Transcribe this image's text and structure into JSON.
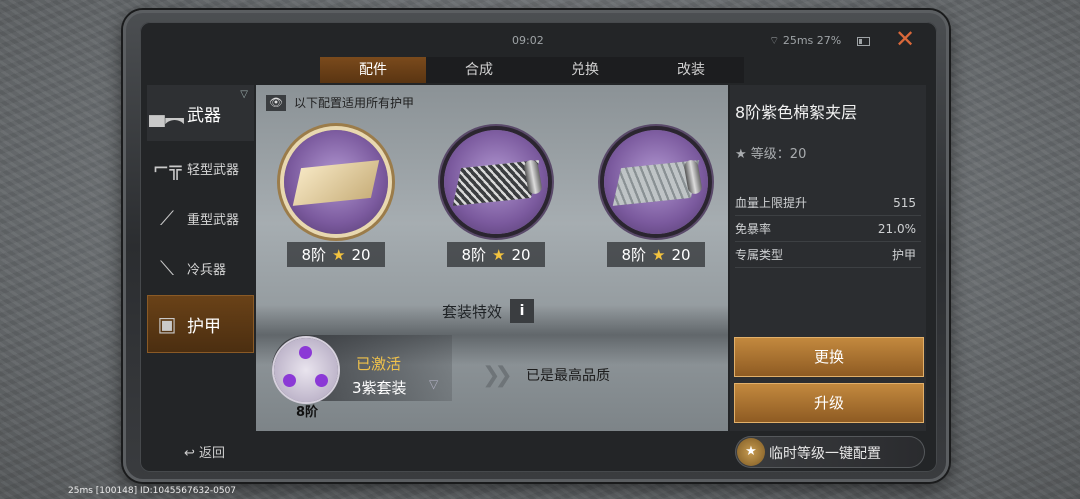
{
  "status": {
    "time": "09:02",
    "network": "25ms",
    "battery": "27%"
  },
  "tabs": [
    {
      "label": "配件"
    },
    {
      "label": "合成"
    },
    {
      "label": "兑换"
    },
    {
      "label": "改装"
    }
  ],
  "sidebar": {
    "weapon": "武器",
    "light": "轻型武器",
    "heavy": "重型武器",
    "melee": "冷兵器",
    "armor": "护甲",
    "back": "返回"
  },
  "notice": "以下配置适用所有护甲",
  "items": [
    {
      "tier": "8阶",
      "stars": "20"
    },
    {
      "tier": "8阶",
      "stars": "20"
    },
    {
      "tier": "8阶",
      "stars": "20"
    }
  ],
  "set": {
    "title": "套装特效",
    "info": "i",
    "status": "已激活",
    "name": "3紫套装",
    "tier": "8阶",
    "max": "已是最高品质"
  },
  "detail": {
    "title": "8阶紫色棉絮夹层",
    "level": "等级：20",
    "stats": [
      {
        "k": "血量上限提升",
        "v": "515"
      },
      {
        "k": "免暴率",
        "v": "21.0%"
      },
      {
        "k": "专属类型",
        "v": "护甲"
      }
    ],
    "replace": "更换",
    "upgrade": "升级"
  },
  "quick_config": "临时等级一键配置",
  "bottom_info": "25ms  [100148] ID:1045567632-0507",
  "colors": {
    "accent": "#c48a3f",
    "tab_active": "#7a4a1c",
    "purple": "#8b39d6",
    "star": "#f3c33e"
  }
}
